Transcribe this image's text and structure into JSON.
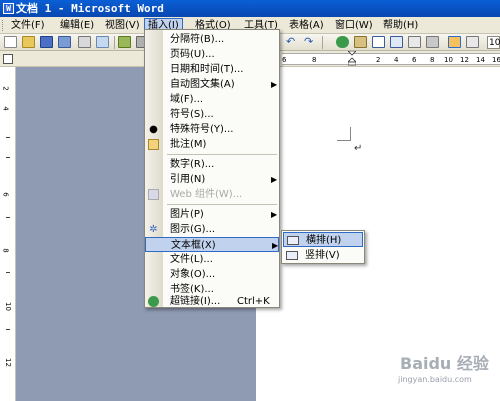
{
  "window": {
    "title": "文档 1 - Microsoft Word"
  },
  "menubar": {
    "items": [
      {
        "label": "文件(F)"
      },
      {
        "label": "编辑(E)"
      },
      {
        "label": "视图(V)"
      },
      {
        "label": "插入(I)"
      },
      {
        "label": "格式(O)"
      },
      {
        "label": "工具(T)"
      },
      {
        "label": "表格(A)"
      },
      {
        "label": "窗口(W)"
      },
      {
        "label": "帮助(H)"
      }
    ],
    "active_index": 3
  },
  "toolbar": {
    "zoom_value": "10"
  },
  "ruler": {
    "ticks": [
      "6",
      "8",
      "2",
      "4",
      "6",
      "8",
      "10",
      "12",
      "14",
      "16"
    ]
  },
  "vruler": {
    "ticks": [
      "2",
      "4",
      "6",
      "8",
      "10",
      "12"
    ]
  },
  "insert_menu": {
    "items": [
      {
        "label": "分隔符(B)...",
        "icon": ""
      },
      {
        "label": "页码(U)...",
        "icon": ""
      },
      {
        "label": "日期和时间(T)...",
        "icon": ""
      },
      {
        "label": "自动图文集(A)",
        "icon": "",
        "submenu": true
      },
      {
        "label": "域(F)...",
        "icon": ""
      },
      {
        "label": "符号(S)...",
        "icon": ""
      },
      {
        "label": "特殊符号(Y)...",
        "icon": "dot-icon"
      },
      {
        "label": "批注(M)",
        "icon": "comment-icon"
      },
      {
        "label": "数字(R)...",
        "icon": ""
      },
      {
        "label": "引用(N)",
        "icon": "",
        "submenu": true
      },
      {
        "label": "Web 组件(W)...",
        "icon": "web-component-icon",
        "disabled": true
      },
      {
        "label": "图片(P)",
        "icon": "",
        "submenu": true
      },
      {
        "label": "图示(G)...",
        "icon": "diagram-icon"
      },
      {
        "label": "文本框(X)",
        "icon": "",
        "submenu": true,
        "highlighted": true
      },
      {
        "label": "文件(L)...",
        "icon": ""
      },
      {
        "label": "对象(O)...",
        "icon": ""
      },
      {
        "label": "书签(K)...",
        "icon": ""
      },
      {
        "label": "超链接(I)...",
        "icon": "hyperlink-icon",
        "shortcut": "Ctrl+K"
      }
    ]
  },
  "textbox_submenu": {
    "items": [
      {
        "label": "横排(H)",
        "highlighted": true
      },
      {
        "label": "竖排(V)"
      }
    ]
  },
  "watermark": {
    "brand": "Baidu 经验",
    "url": "jingyan.baidu.com"
  },
  "colors": {
    "titlebar": "#0847b0",
    "menu_highlight": "#c1d2ee",
    "menu_highlight_border": "#316ac5",
    "workspace_gray": "#8f9ab3"
  }
}
